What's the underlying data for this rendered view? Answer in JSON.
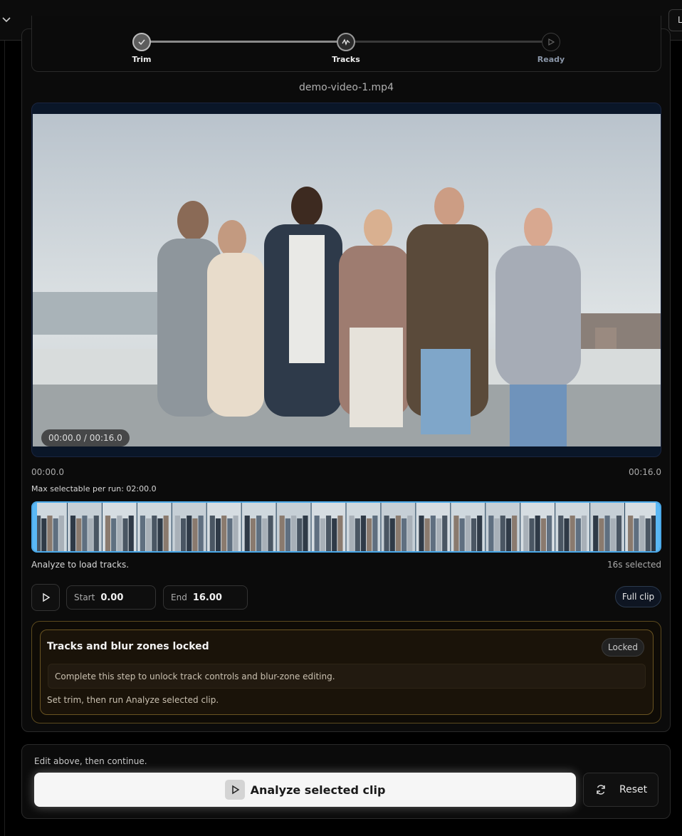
{
  "header": {
    "language_button": "L"
  },
  "stepper": {
    "steps": [
      {
        "label": "Trim",
        "state": "done"
      },
      {
        "label": "Tracks",
        "state": "active"
      },
      {
        "label": "Ready",
        "state": "todo"
      }
    ]
  },
  "video": {
    "filename": "demo-video-1.mp4",
    "time_display": "00:00.0 / 00:16.0"
  },
  "timeline": {
    "start_time": "00:00.0",
    "end_time": "00:16.0",
    "max_selectable": "Max selectable per run: 02:00.0",
    "status": "Analyze to load tracks.",
    "selected": "16s selected"
  },
  "trim": {
    "start_label": "Start",
    "start_value": "0.00",
    "end_label": "End",
    "end_value": "16.00",
    "full_clip_label": "Full clip"
  },
  "locked_panel": {
    "title": "Tracks and blur zones locked",
    "badge": "Locked",
    "message": "Complete this step to unlock track controls and blur-zone editing.",
    "hint": "Set trim, then run Analyze selected clip."
  },
  "footer": {
    "note": "Edit above, then continue.",
    "analyze_label": "Analyze selected clip",
    "reset_label": "Reset"
  },
  "colors": {
    "accent": "#4aa8e8",
    "locked_border": "#6a5422",
    "primary_button": "#f6f6f6"
  },
  "icons": {
    "stepper": [
      "check-icon",
      "waveform-icon",
      "play-icon"
    ],
    "play": "play-icon",
    "reset": "refresh-icon",
    "dropdown": "chevron-down-icon"
  }
}
